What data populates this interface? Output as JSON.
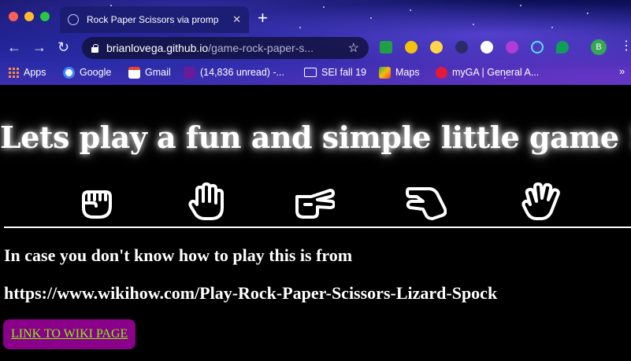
{
  "browser": {
    "tab_title": "Rock Paper Scissors via promp",
    "tab_close": "✕",
    "new_tab": "+",
    "url_domain": "brianlovega.github.io",
    "url_path": "/game-rock-paper-s...",
    "back": "←",
    "forward": "→",
    "reload": "↻",
    "star": "☆",
    "avatar_letter": "B",
    "menu": "⋮",
    "bookmarks": [
      {
        "label": "Apps"
      },
      {
        "label": "Google"
      },
      {
        "label": "Gmail"
      },
      {
        "label": "(14,836 unread) -..."
      },
      {
        "label": "SEI fall 19"
      },
      {
        "label": "Maps"
      },
      {
        "label": "myGA | General A..."
      }
    ],
    "more_bookmarks": "»",
    "accent": "#1a1f8a"
  },
  "page": {
    "headline": "Lets play a fun and simple little game !",
    "choices": [
      "rock",
      "paper",
      "scissors",
      "lizard",
      "spock"
    ],
    "info_line": "In case you don't know how to play this is from",
    "source_url": "https://www.wikihow.com/Play-Rock-Paper-Scissors-Lizard-Spock",
    "wiki_button": "LINK TO WIKI PAGE",
    "colors": {
      "background": "#000000",
      "text": "#ffffff",
      "button_bg": "#8b008b",
      "button_text": "#7cfc00"
    }
  }
}
